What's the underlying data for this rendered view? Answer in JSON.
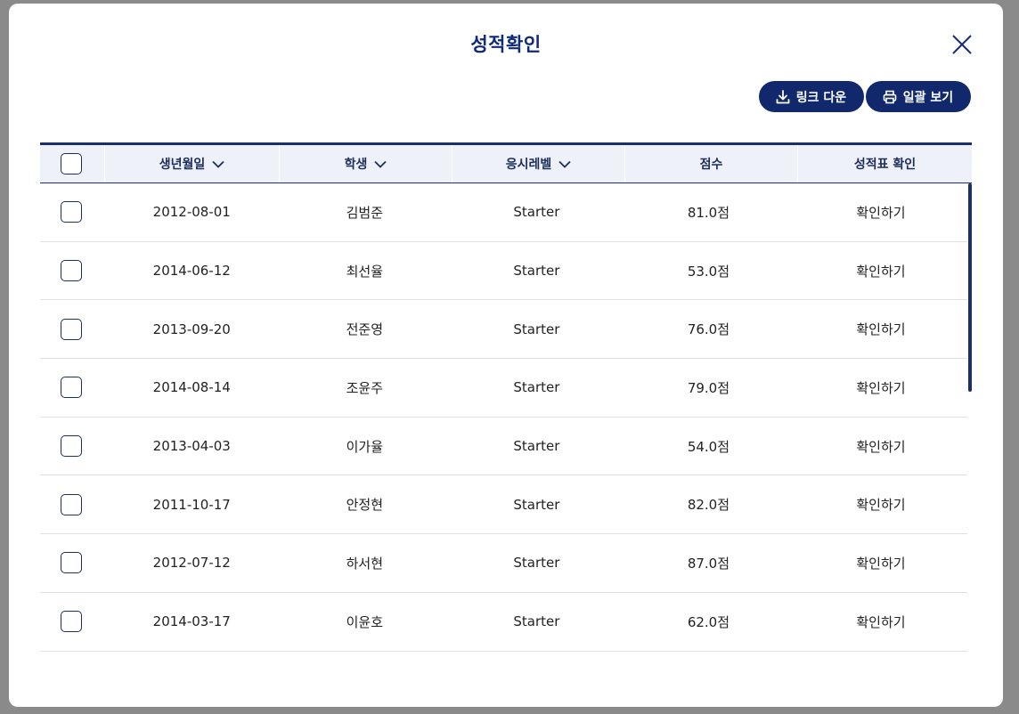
{
  "modal": {
    "title": "성적확인",
    "actions": {
      "download_label": "링크 다운",
      "print_label": "일괄 보기"
    }
  },
  "table": {
    "headers": {
      "birthdate": "생년월일",
      "student": "학생",
      "level": "응시레벨",
      "score": "점수",
      "report": "성적표 확인"
    },
    "rows": [
      {
        "birthdate": "2012-08-01",
        "student": "김범준",
        "level": "Starter",
        "score": "81.0점",
        "report": "확인하기"
      },
      {
        "birthdate": "2014-06-12",
        "student": "최선율",
        "level": "Starter",
        "score": "53.0점",
        "report": "확인하기"
      },
      {
        "birthdate": "2013-09-20",
        "student": "전준영",
        "level": "Starter",
        "score": "76.0점",
        "report": "확인하기"
      },
      {
        "birthdate": "2014-08-14",
        "student": "조윤주",
        "level": "Starter",
        "score": "79.0점",
        "report": "확인하기"
      },
      {
        "birthdate": "2013-04-03",
        "student": "이가율",
        "level": "Starter",
        "score": "54.0점",
        "report": "확인하기"
      },
      {
        "birthdate": "2011-10-17",
        "student": "안정현",
        "level": "Starter",
        "score": "82.0점",
        "report": "확인하기"
      },
      {
        "birthdate": "2012-07-12",
        "student": "하서현",
        "level": "Starter",
        "score": "87.0점",
        "report": "확인하기"
      },
      {
        "birthdate": "2014-03-17",
        "student": "이윤호",
        "level": "Starter",
        "score": "62.0점",
        "report": "확인하기"
      }
    ]
  },
  "colors": {
    "primary": "#11286d",
    "title": "#0f2a78",
    "header_bg": "#eef1f7"
  }
}
